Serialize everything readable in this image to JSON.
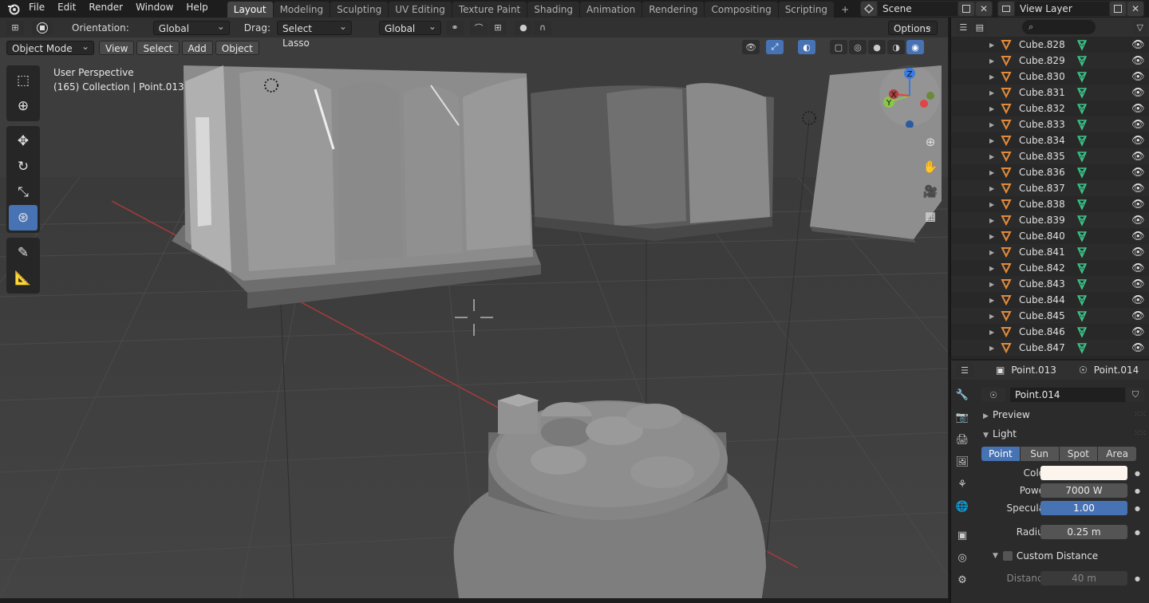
{
  "app": {
    "menu": [
      "File",
      "Edit",
      "Render",
      "Window",
      "Help"
    ],
    "workspace_tabs": [
      {
        "label": "Layout",
        "active": true
      },
      {
        "label": "Modeling"
      },
      {
        "label": "Sculpting"
      },
      {
        "label": "UV Editing"
      },
      {
        "label": "Texture Paint"
      },
      {
        "label": "Shading"
      },
      {
        "label": "Animation"
      },
      {
        "label": "Rendering"
      },
      {
        "label": "Compositing"
      },
      {
        "label": "Scripting"
      }
    ],
    "scene_name": "Scene",
    "view_layer": "View Layer"
  },
  "viewport_header": {
    "orientation_label": "Orientation:",
    "orientation_value": "Global",
    "drag_label": "Drag:",
    "drag_value": "Select Lasso",
    "pivot_value": "Global",
    "options_label": "Options",
    "mode": "Object Mode",
    "menus": [
      "View",
      "Select",
      "Add",
      "Object"
    ]
  },
  "viewport_info": {
    "perspective": "User Perspective",
    "collection": "(165) Collection | Point.013"
  },
  "gizmo": {
    "x": "X",
    "y": "Y",
    "z": "Z"
  },
  "outliner": {
    "search_placeholder": "",
    "items": [
      "Cube.828",
      "Cube.829",
      "Cube.830",
      "Cube.831",
      "Cube.832",
      "Cube.833",
      "Cube.834",
      "Cube.835",
      "Cube.836",
      "Cube.837",
      "Cube.838",
      "Cube.839",
      "Cube.840",
      "Cube.841",
      "Cube.842",
      "Cube.843",
      "Cube.844",
      "Cube.845",
      "Cube.846",
      "Cube.847"
    ]
  },
  "properties": {
    "object_name": "Point.013",
    "data_name": "Point.014",
    "datablock": "Point.014",
    "preview_panel": "Preview",
    "light_panel": "Light",
    "light_types": [
      {
        "label": "Point",
        "active": true
      },
      {
        "label": "Sun"
      },
      {
        "label": "Spot"
      },
      {
        "label": "Area"
      }
    ],
    "color_label": "Color",
    "color_value": "#fcf5ee",
    "power_label": "Power",
    "power_value": "7000 W",
    "specular_label": "Specular",
    "specular_value": "1.00",
    "radius_label": "Radius",
    "radius_value": "0.25 m",
    "custom_distance_label": "Custom Distance",
    "distance_label": "Distance",
    "distance_value": "40 m"
  },
  "colors": {
    "accent": "#4772b3",
    "mesh_icon": "#e08b3a",
    "mesh_data_icon": "#3ac68a",
    "x_axis": "#e04444",
    "y_axis": "#8ac64a",
    "z_axis": "#3a7be0"
  }
}
